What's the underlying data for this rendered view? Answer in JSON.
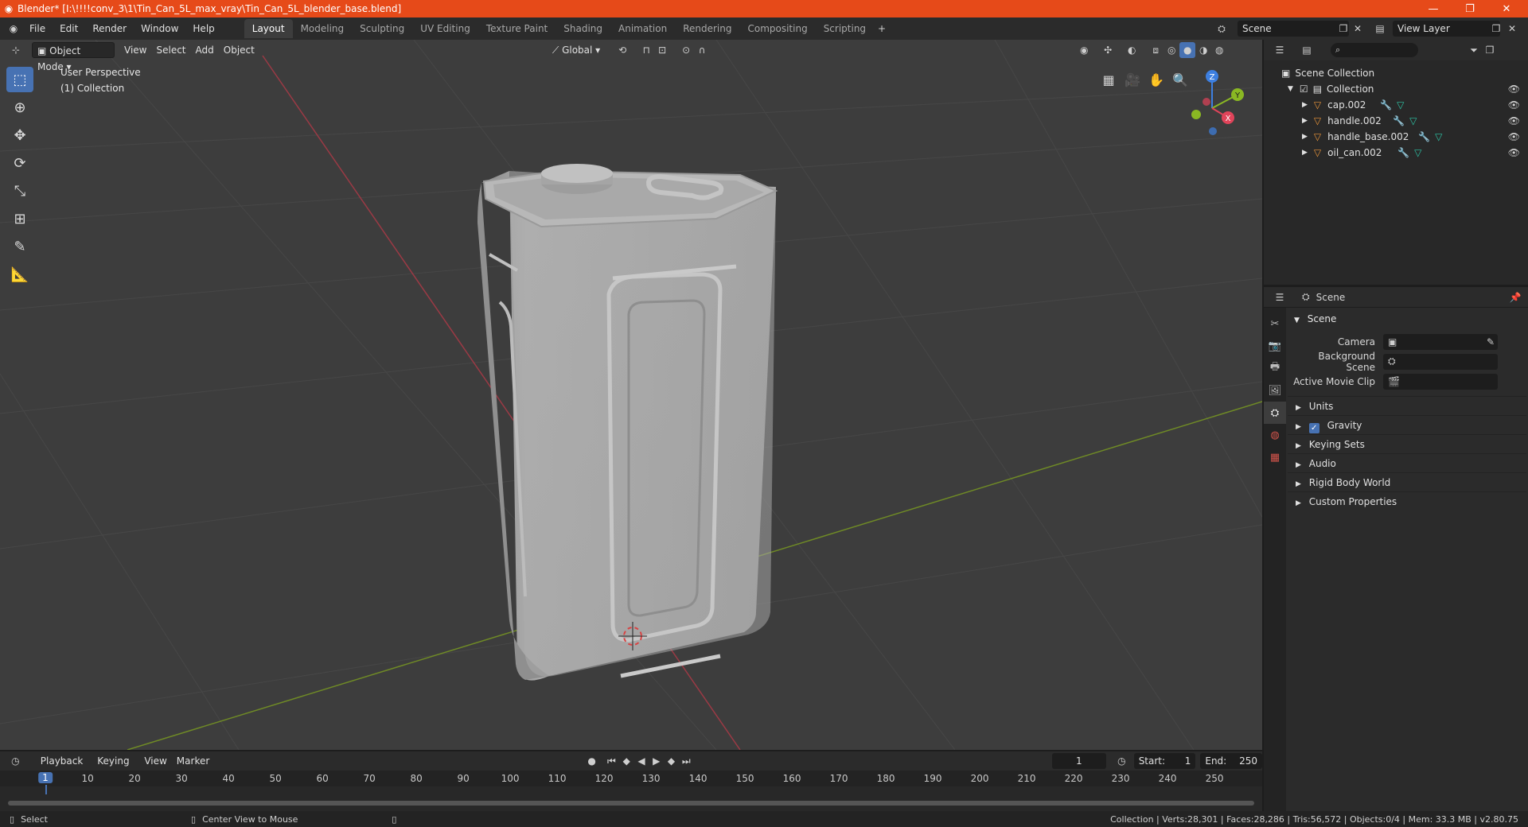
{
  "window": {
    "title": "Blender* [I:\\!!!!conv_3\\1\\Tin_Can_5L_max_vray\\Tin_Can_5L_blender_base.blend]",
    "controls": [
      "minimize-icon",
      "restore-icon",
      "close-icon"
    ]
  },
  "menu": [
    "File",
    "Edit",
    "Render",
    "Window",
    "Help"
  ],
  "workspaces": [
    {
      "label": "Layout",
      "active": true
    },
    {
      "label": "Modeling",
      "active": false
    },
    {
      "label": "Sculpting",
      "active": false
    },
    {
      "label": "UV Editing",
      "active": false
    },
    {
      "label": "Texture Paint",
      "active": false
    },
    {
      "label": "Shading",
      "active": false
    },
    {
      "label": "Animation",
      "active": false
    },
    {
      "label": "Rendering",
      "active": false
    },
    {
      "label": "Compositing",
      "active": false
    },
    {
      "label": "Scripting",
      "active": false
    }
  ],
  "scene_name": "Scene",
  "view_layer": "View Layer",
  "viewport": {
    "mode": "Object Mode",
    "menus": [
      "View",
      "Select",
      "Add",
      "Object"
    ],
    "orientation": "Global",
    "overlay_text": [
      "User Perspective",
      "(1) Collection"
    ],
    "gizmo_labels": {
      "z": "Z",
      "y": "Y",
      "x": "X"
    }
  },
  "outliner": {
    "root": "Scene Collection",
    "collection": "Collection",
    "objects": [
      "cap.002",
      "handle.002",
      "handle_base.002",
      "oil_can.002"
    ]
  },
  "properties": {
    "header": "Scene",
    "panel": "Scene",
    "fields": [
      {
        "label": "Camera",
        "value": ""
      },
      {
        "label": "Background Scene",
        "value": ""
      },
      {
        "label": "Active Movie Clip",
        "value": ""
      }
    ],
    "subpanels": [
      {
        "label": "Units",
        "checkbox": false
      },
      {
        "label": "Gravity",
        "checkbox": true
      },
      {
        "label": "Keying Sets",
        "checkbox": false
      },
      {
        "label": "Audio",
        "checkbox": false
      },
      {
        "label": "Rigid Body World",
        "checkbox": false
      },
      {
        "label": "Custom Properties",
        "checkbox": false
      }
    ]
  },
  "timeline": {
    "menus": [
      "Playback",
      "Keying",
      "View",
      "Marker"
    ],
    "current_frame": "1",
    "start_label": "Start:",
    "start": "1",
    "end_label": "End:",
    "end": "250",
    "ticks": [
      "1",
      "10",
      "20",
      "30",
      "40",
      "50",
      "60",
      "70",
      "80",
      "90",
      "100",
      "110",
      "120",
      "130",
      "140",
      "150",
      "160",
      "170",
      "180",
      "190",
      "200",
      "210",
      "220",
      "230",
      "240",
      "250"
    ]
  },
  "statusbar": {
    "left": "Select",
    "middle": "Center View to Mouse",
    "right": "Collection | Verts:28,301 | Faces:28,286 | Tris:56,572 | Objects:0/4 | Mem: 33.3 MB | v2.80.75"
  },
  "colors": {
    "titlebar": "#e64a19",
    "accent": "#4772b3",
    "object_icon": "#e8943a",
    "modifier_icon": "#6fa8dc",
    "mesh_icon": "#2ec4a6",
    "axis_x": "#e0445a",
    "axis_y": "#8ab823",
    "axis_z": "#3d7fe0"
  }
}
